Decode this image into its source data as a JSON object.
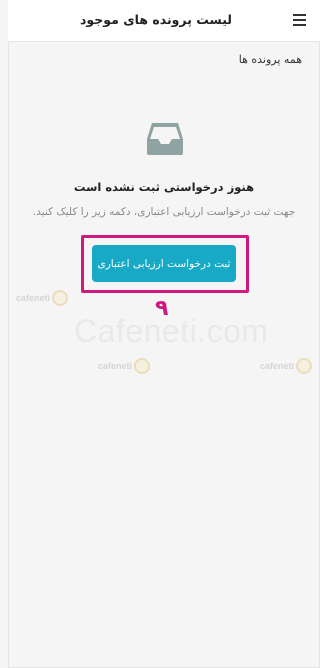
{
  "header": {
    "title": "لیست پرونده های موجود",
    "menu_icon": "hamburger-menu-icon"
  },
  "section": {
    "label": "همه پرونده ها"
  },
  "empty_state": {
    "icon": "inbox-tray-icon",
    "title": "هنوز درخواستی ثبت نشده است",
    "description": "جهت ثبت درخواست ارزیابی اعتباری، دکمه زیر را کلیک کنید.",
    "button_label": "ثبت درخواست ارزیابی اعتباری"
  },
  "annotation": {
    "step_number": "۹",
    "highlight_color": "#d0197e"
  },
  "watermark": {
    "text": "Cafeneti.com",
    "logo_word": "cafeneti"
  },
  "colors": {
    "button": "#17a9c6",
    "icon": "#8fa3a3",
    "highlight": "#d0197e"
  }
}
